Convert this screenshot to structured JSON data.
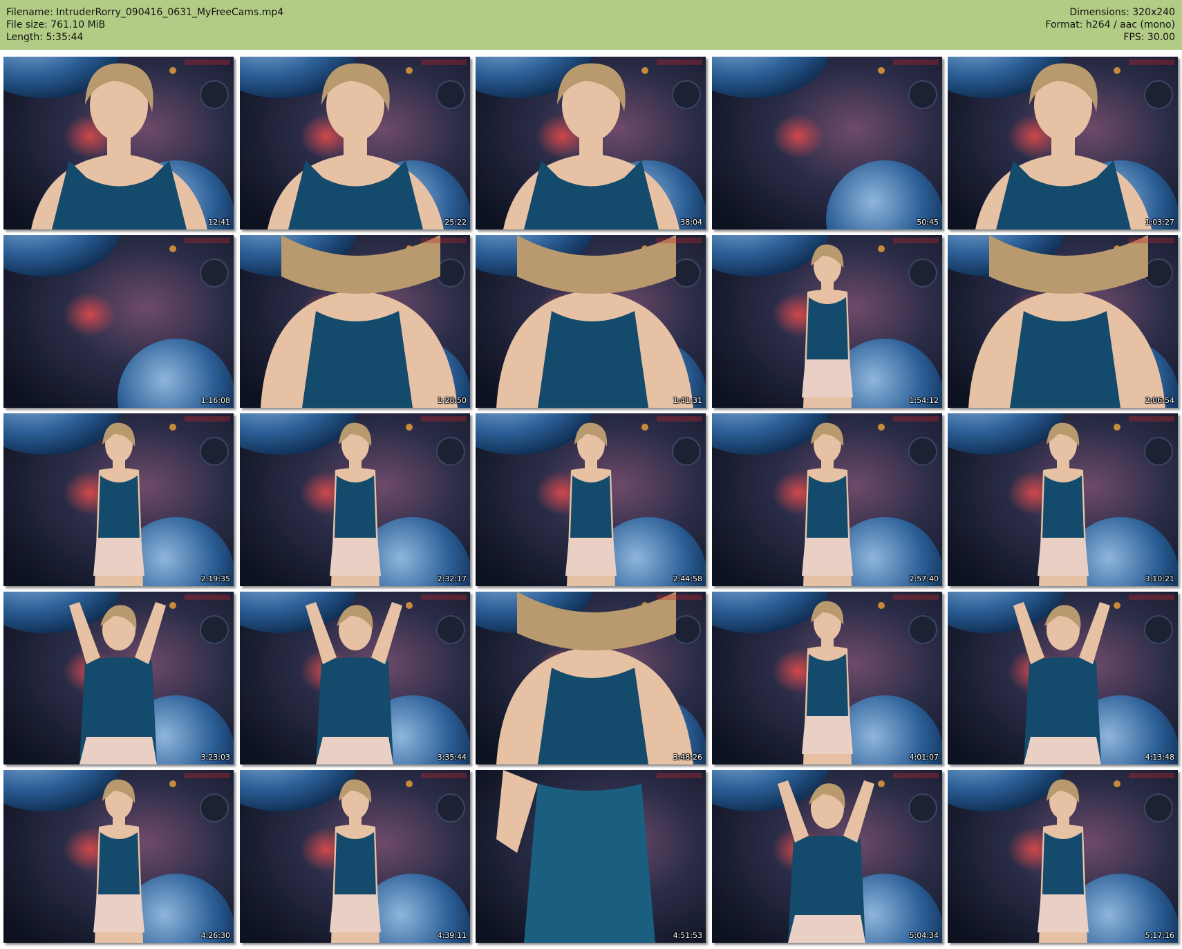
{
  "header": {
    "filename": "Filename: IntruderRorry_090416_0631_MyFreeCams.mp4",
    "filesize": "File size: 761.10 MiB",
    "length": "Length: 5:35:44",
    "dimensions": "Dimensions: 320x240",
    "format": "Format: h264 / aac (mono)",
    "fps": "FPS: 30.00"
  },
  "colors": {
    "header_background": "#b3cc85",
    "page_background": "#ffffff"
  },
  "thumbnails": [
    {
      "timestamp": "12:41",
      "scene": "closeup"
    },
    {
      "timestamp": "25:22",
      "scene": "closeup"
    },
    {
      "timestamp": "38:04",
      "scene": "closeup"
    },
    {
      "timestamp": "50:45",
      "scene": "empty"
    },
    {
      "timestamp": "1:03:27",
      "scene": "closeup"
    },
    {
      "timestamp": "1:16:08",
      "scene": "empty"
    },
    {
      "timestamp": "1:28:50",
      "scene": "lean"
    },
    {
      "timestamp": "1:41:31",
      "scene": "lean"
    },
    {
      "timestamp": "1:54:12",
      "scene": "standing"
    },
    {
      "timestamp": "2:06:54",
      "scene": "lean"
    },
    {
      "timestamp": "2:19:35",
      "scene": "standing"
    },
    {
      "timestamp": "2:32:17",
      "scene": "standing"
    },
    {
      "timestamp": "2:44:58",
      "scene": "standing"
    },
    {
      "timestamp": "2:57:40",
      "scene": "standing"
    },
    {
      "timestamp": "3:10:21",
      "scene": "standing"
    },
    {
      "timestamp": "3:23:03",
      "scene": "arms-up"
    },
    {
      "timestamp": "3:35:44",
      "scene": "arms-up"
    },
    {
      "timestamp": "3:48:26",
      "scene": "lean"
    },
    {
      "timestamp": "4:01:07",
      "scene": "standing"
    },
    {
      "timestamp": "4:13:48",
      "scene": "arms-up"
    },
    {
      "timestamp": "4:26:30",
      "scene": "standing"
    },
    {
      "timestamp": "4:39:11",
      "scene": "standing"
    },
    {
      "timestamp": "4:51:53",
      "scene": "torso"
    },
    {
      "timestamp": "5:04:34",
      "scene": "arms-up"
    },
    {
      "timestamp": "5:17:16",
      "scene": "standing"
    }
  ]
}
